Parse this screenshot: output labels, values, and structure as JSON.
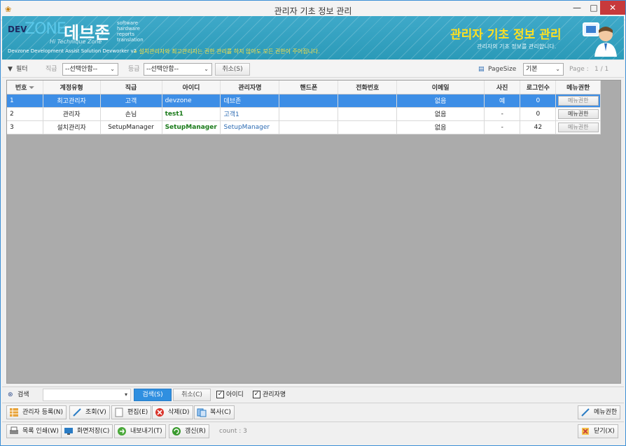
{
  "window": {
    "title": "관리자 기초 정보 관리",
    "minimize": "—",
    "maximize": "□",
    "close": "✕"
  },
  "banner": {
    "logo_dev": "DEV",
    "logo_zone": "ZONE",
    "logo_hangul": "데브존",
    "logo_tagline": "Hi Technique Zone",
    "logo_words": [
      "software",
      "hardware",
      "reports",
      "translation"
    ],
    "subtitle": "Devzone Development Assist Solution Devworker v2",
    "notice": "» 설치관리자와 최고관리자는 권한 관리를 하지 않아도 모든 권한이 주어집니다.",
    "title": "관리자 기초 정보 관리",
    "description": "관리자의 기초 정보를 관리합니다."
  },
  "toolbar": {
    "filter_label": "필터",
    "rank_label": "직급",
    "rank_value": "--선택안함--",
    "grade_label": "등급",
    "grade_value": "--선택안함--",
    "cancel_label": "취소(S)",
    "pagesize_label": "PageSize",
    "pagesize_value": "기본",
    "page_label": "Page :",
    "page_value": "1  /  1"
  },
  "grid": {
    "columns": [
      "번호",
      "계정유형",
      "직급",
      "아이디",
      "관리자명",
      "핸드폰",
      "전화번호",
      "이메일",
      "사진",
      "로그인수",
      "메뉴권한"
    ],
    "rows": [
      {
        "no": "1",
        "type": "최고관리자",
        "rank": "고객",
        "id": "devzone",
        "name": "데브존",
        "mobile": "",
        "phone": "",
        "email": "없음",
        "photo": "예",
        "logins": "0",
        "menu": "메뉴권한"
      },
      {
        "no": "2",
        "type": "관리자",
        "rank": "손님",
        "id": "test1",
        "name": "고객1",
        "mobile": "",
        "phone": "",
        "email": "없음",
        "photo": "-",
        "logins": "0",
        "menu": "메뉴권한"
      },
      {
        "no": "3",
        "type": "설치관리자",
        "rank": "SetupManager",
        "id": "SetupManager",
        "name": "SetupManager",
        "mobile": "",
        "phone": "",
        "email": "없음",
        "photo": "-",
        "logins": "42",
        "menu": "메뉴권한"
      }
    ]
  },
  "search": {
    "label": "검색",
    "input_value": "",
    "search_button": "검색(S)",
    "cancel_button": "취소(C)",
    "check_id_label": "아이디",
    "check_name_label": "관리자명",
    "check_id": true,
    "check_name": true
  },
  "actions": {
    "register": "관리자 등록(N)",
    "view": "조회(V)",
    "edit": "편집(E)",
    "delete": "삭제(D)",
    "copy": "복사(C)",
    "menu_permission": "메뉴권한",
    "print": "목록 인쇄(W)",
    "save_screen": "화면저장(C)",
    "export": "내보내기(T)",
    "refresh": "갱신(R)",
    "count": "count : 3",
    "close": "닫기(X)"
  },
  "colors": {
    "banner": "#2b9ab8",
    "selected_row": "#3d8ee6",
    "close_button": "#c7393b",
    "banner_title": "#ffe020"
  }
}
